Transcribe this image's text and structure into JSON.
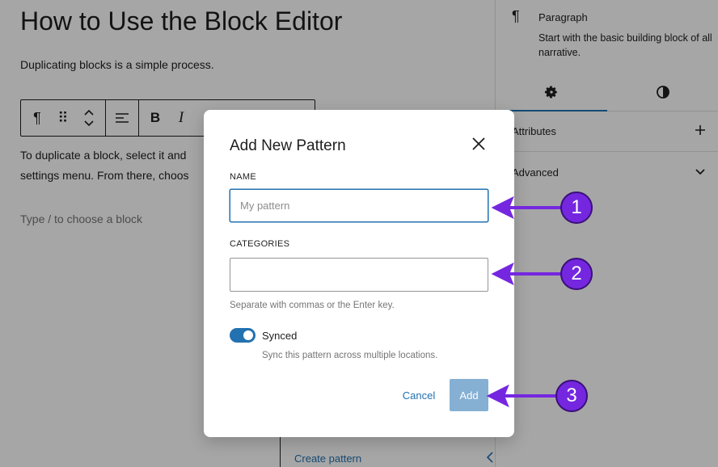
{
  "editor": {
    "title": "How to Use the Block Editor",
    "intro": "Duplicating blocks is a simple process.",
    "body_line1": "To duplicate a block, select it and",
    "body_line2": "settings menu. From there, choos",
    "placeholder": "Type / to choose a block",
    "toolbar": {
      "paragraph_icon": "¶",
      "drag_icon": "⠿",
      "bold": "B",
      "italic": "I"
    },
    "dropdown": {
      "create_pattern": "Create pattern"
    }
  },
  "sidebar": {
    "symbol": "¶",
    "block_name": "Paragraph",
    "block_description": "Start with the basic building block of all narrative.",
    "tabs": [
      {
        "icon": "gear-icon",
        "active": true
      },
      {
        "icon": "half-circle-icon",
        "active": false
      }
    ],
    "attributes_label": "Attributes",
    "advanced_label": "Advanced"
  },
  "modal": {
    "title": "Add New Pattern",
    "name_label": "NAME",
    "name_placeholder": "My pattern",
    "name_value": "",
    "categories_label": "CATEGORIES",
    "categories_value": "",
    "categories_help": "Separate with commas or the Enter key.",
    "synced_label": "Synced",
    "synced_on": true,
    "synced_help": "Sync this pattern across multiple locations.",
    "cancel_label": "Cancel",
    "add_label": "Add"
  },
  "annotations": {
    "badge1": "1",
    "badge2": "2",
    "badge3": "3",
    "color": "#7527e0"
  },
  "colors": {
    "accent": "#2271b1",
    "annotation": "#7527e0"
  }
}
